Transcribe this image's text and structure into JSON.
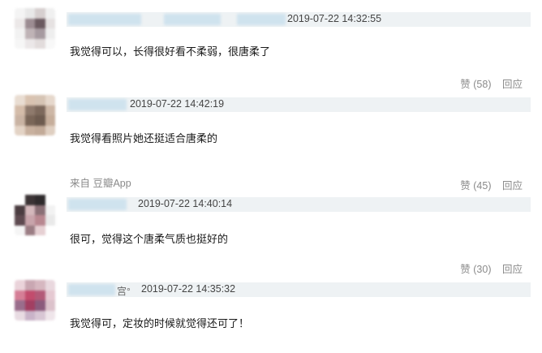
{
  "comments": [
    {
      "timestamp": "2019-07-22 14:32:55",
      "text": "我觉得可以，长得很好看不柔弱，很唐柔了",
      "like_label": "赞 (58)",
      "reply_label": "回应",
      "avatar_colors": [
        "#f4f4f4",
        "#e8e8e8",
        "#d6cfcf",
        "#f0f0f0",
        "#ece8e8",
        "#9c8c92",
        "#6b5a60",
        "#e6e2e2",
        "#f2f2f2",
        "#bfb3b6",
        "#a69aa0",
        "#eeeeee",
        "#f6f6f6",
        "#ebe7e8",
        "#e2dcdc",
        "#f8f8f8"
      ]
    },
    {
      "timestamp": "2019-07-22 14:42:19",
      "text": "我觉得看照片她还挺适合唐柔的",
      "source": "来自 豆瓣App",
      "like_label": "赞 (45)",
      "reply_label": "回应",
      "avatar_colors": [
        "#e9ddd2",
        "#d9c3b1",
        "#d6c4b4",
        "#e6d8cc",
        "#d4bca9",
        "#8f7a6d",
        "#7d695c",
        "#cdb7a6",
        "#c9b3a3",
        "#7a6658",
        "#6d5b4f",
        "#c6ae9b",
        "#e3d3c5",
        "#c8b09e",
        "#c2aa98",
        "#dfcfc1"
      ]
    },
    {
      "timestamp": "2019-07-22 14:40:14",
      "text": "很可，觉得这个唐柔气质也挺好的",
      "like_label": "赞 (30)",
      "reply_label": "回应",
      "avatar_colors": [
        "#ffffff",
        "#3b3335",
        "#2e2a2c",
        "#ffffff",
        "#4a3c40",
        "#d4b8bc",
        "#8a6f76",
        "#f2f2f2",
        "#5e4a50",
        "#c8a4ab",
        "#b88790",
        "#e9e9e9",
        "#f5f5f5",
        "#9b7d84",
        "#e6d0d3",
        "#ffffff"
      ]
    },
    {
      "timestamp": "2019-07-22 14:35:32",
      "name_suffix": "宫°",
      "text": "我觉得可，定妆的时候就觉得还可了！",
      "avatar_colors": [
        "#ead3da",
        "#c9a7b2",
        "#d6b7c0",
        "#e9d8de",
        "#d57e96",
        "#c24c6d",
        "#b35a78",
        "#e5c9d2",
        "#9a6d8c",
        "#a23f62",
        "#8b5a7c",
        "#dcc2cb",
        "#e8dbe2",
        "#c9b3c8",
        "#d8c6d4",
        "#efe5ea"
      ]
    }
  ]
}
